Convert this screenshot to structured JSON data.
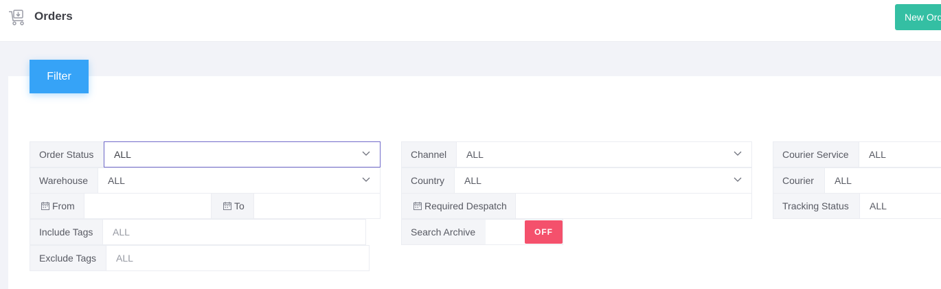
{
  "header": {
    "title": "Orders",
    "new_button_label": "New Order"
  },
  "filter": {
    "tab_label": "Filter",
    "order_status": {
      "label": "Order Status",
      "value": "ALL"
    },
    "warehouse": {
      "label": "Warehouse",
      "value": "ALL"
    },
    "from": {
      "label": "From",
      "value": ""
    },
    "to": {
      "label": "To",
      "value": ""
    },
    "include_tags": {
      "label": "Include Tags",
      "placeholder": "ALL"
    },
    "exclude_tags": {
      "label": "Exclude Tags",
      "placeholder": "ALL"
    },
    "channel": {
      "label": "Channel",
      "value": "ALL"
    },
    "country": {
      "label": "Country",
      "value": "ALL"
    },
    "required_despatch": {
      "label": "Required Despatch",
      "value": ""
    },
    "search_archive": {
      "label": "Search Archive",
      "state": "OFF"
    },
    "courier_service": {
      "label": "Courier Service",
      "value": "ALL"
    },
    "courier": {
      "label": "Courier",
      "value": "ALL"
    },
    "tracking_status": {
      "label": "Tracking Status",
      "value": "ALL"
    }
  },
  "colors": {
    "accent": "#36a3f7",
    "success": "#34bfa3",
    "danger": "#f4516c",
    "focus": "#716aca"
  },
  "icons": {
    "header": "cart-icon",
    "date": "calendar-icon",
    "dropdown": "chevron-down-icon"
  }
}
